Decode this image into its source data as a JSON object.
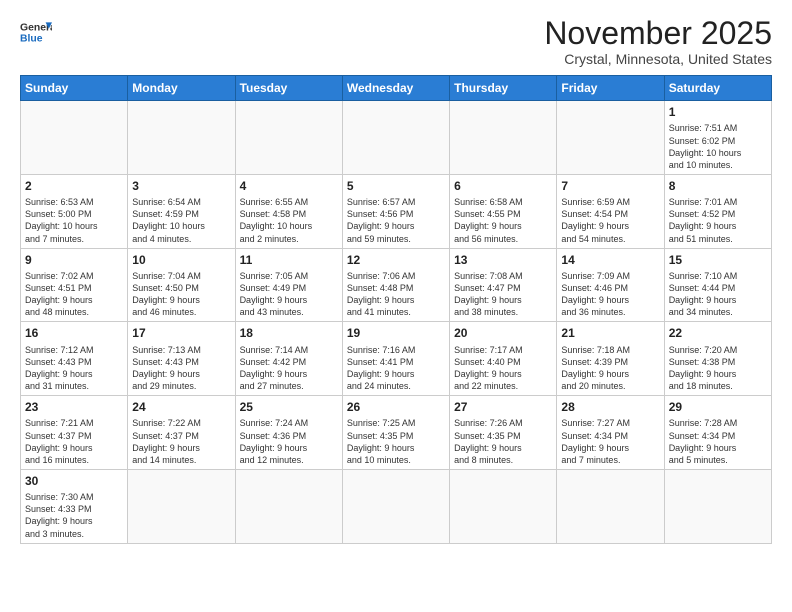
{
  "header": {
    "logo_general": "General",
    "logo_blue": "Blue",
    "month_title": "November 2025",
    "location": "Crystal, Minnesota, United States"
  },
  "weekdays": [
    "Sunday",
    "Monday",
    "Tuesday",
    "Wednesday",
    "Thursday",
    "Friday",
    "Saturday"
  ],
  "weeks": [
    [
      {
        "day": "",
        "info": ""
      },
      {
        "day": "",
        "info": ""
      },
      {
        "day": "",
        "info": ""
      },
      {
        "day": "",
        "info": ""
      },
      {
        "day": "",
        "info": ""
      },
      {
        "day": "",
        "info": ""
      },
      {
        "day": "1",
        "info": "Sunrise: 7:51 AM\nSunset: 6:02 PM\nDaylight: 10 hours\nand 10 minutes."
      }
    ],
    [
      {
        "day": "2",
        "info": "Sunrise: 6:53 AM\nSunset: 5:00 PM\nDaylight: 10 hours\nand 7 minutes."
      },
      {
        "day": "3",
        "info": "Sunrise: 6:54 AM\nSunset: 4:59 PM\nDaylight: 10 hours\nand 4 minutes."
      },
      {
        "day": "4",
        "info": "Sunrise: 6:55 AM\nSunset: 4:58 PM\nDaylight: 10 hours\nand 2 minutes."
      },
      {
        "day": "5",
        "info": "Sunrise: 6:57 AM\nSunset: 4:56 PM\nDaylight: 9 hours\nand 59 minutes."
      },
      {
        "day": "6",
        "info": "Sunrise: 6:58 AM\nSunset: 4:55 PM\nDaylight: 9 hours\nand 56 minutes."
      },
      {
        "day": "7",
        "info": "Sunrise: 6:59 AM\nSunset: 4:54 PM\nDaylight: 9 hours\nand 54 minutes."
      },
      {
        "day": "8",
        "info": "Sunrise: 7:01 AM\nSunset: 4:52 PM\nDaylight: 9 hours\nand 51 minutes."
      }
    ],
    [
      {
        "day": "9",
        "info": "Sunrise: 7:02 AM\nSunset: 4:51 PM\nDaylight: 9 hours\nand 48 minutes."
      },
      {
        "day": "10",
        "info": "Sunrise: 7:04 AM\nSunset: 4:50 PM\nDaylight: 9 hours\nand 46 minutes."
      },
      {
        "day": "11",
        "info": "Sunrise: 7:05 AM\nSunset: 4:49 PM\nDaylight: 9 hours\nand 43 minutes."
      },
      {
        "day": "12",
        "info": "Sunrise: 7:06 AM\nSunset: 4:48 PM\nDaylight: 9 hours\nand 41 minutes."
      },
      {
        "day": "13",
        "info": "Sunrise: 7:08 AM\nSunset: 4:47 PM\nDaylight: 9 hours\nand 38 minutes."
      },
      {
        "day": "14",
        "info": "Sunrise: 7:09 AM\nSunset: 4:46 PM\nDaylight: 9 hours\nand 36 minutes."
      },
      {
        "day": "15",
        "info": "Sunrise: 7:10 AM\nSunset: 4:44 PM\nDaylight: 9 hours\nand 34 minutes."
      }
    ],
    [
      {
        "day": "16",
        "info": "Sunrise: 7:12 AM\nSunset: 4:43 PM\nDaylight: 9 hours\nand 31 minutes."
      },
      {
        "day": "17",
        "info": "Sunrise: 7:13 AM\nSunset: 4:43 PM\nDaylight: 9 hours\nand 29 minutes."
      },
      {
        "day": "18",
        "info": "Sunrise: 7:14 AM\nSunset: 4:42 PM\nDaylight: 9 hours\nand 27 minutes."
      },
      {
        "day": "19",
        "info": "Sunrise: 7:16 AM\nSunset: 4:41 PM\nDaylight: 9 hours\nand 24 minutes."
      },
      {
        "day": "20",
        "info": "Sunrise: 7:17 AM\nSunset: 4:40 PM\nDaylight: 9 hours\nand 22 minutes."
      },
      {
        "day": "21",
        "info": "Sunrise: 7:18 AM\nSunset: 4:39 PM\nDaylight: 9 hours\nand 20 minutes."
      },
      {
        "day": "22",
        "info": "Sunrise: 7:20 AM\nSunset: 4:38 PM\nDaylight: 9 hours\nand 18 minutes."
      }
    ],
    [
      {
        "day": "23",
        "info": "Sunrise: 7:21 AM\nSunset: 4:37 PM\nDaylight: 9 hours\nand 16 minutes."
      },
      {
        "day": "24",
        "info": "Sunrise: 7:22 AM\nSunset: 4:37 PM\nDaylight: 9 hours\nand 14 minutes."
      },
      {
        "day": "25",
        "info": "Sunrise: 7:24 AM\nSunset: 4:36 PM\nDaylight: 9 hours\nand 12 minutes."
      },
      {
        "day": "26",
        "info": "Sunrise: 7:25 AM\nSunset: 4:35 PM\nDaylight: 9 hours\nand 10 minutes."
      },
      {
        "day": "27",
        "info": "Sunrise: 7:26 AM\nSunset: 4:35 PM\nDaylight: 9 hours\nand 8 minutes."
      },
      {
        "day": "28",
        "info": "Sunrise: 7:27 AM\nSunset: 4:34 PM\nDaylight: 9 hours\nand 7 minutes."
      },
      {
        "day": "29",
        "info": "Sunrise: 7:28 AM\nSunset: 4:34 PM\nDaylight: 9 hours\nand 5 minutes."
      }
    ],
    [
      {
        "day": "30",
        "info": "Sunrise: 7:30 AM\nSunset: 4:33 PM\nDaylight: 9 hours\nand 3 minutes."
      },
      {
        "day": "",
        "info": ""
      },
      {
        "day": "",
        "info": ""
      },
      {
        "day": "",
        "info": ""
      },
      {
        "day": "",
        "info": ""
      },
      {
        "day": "",
        "info": ""
      },
      {
        "day": "",
        "info": ""
      }
    ]
  ]
}
